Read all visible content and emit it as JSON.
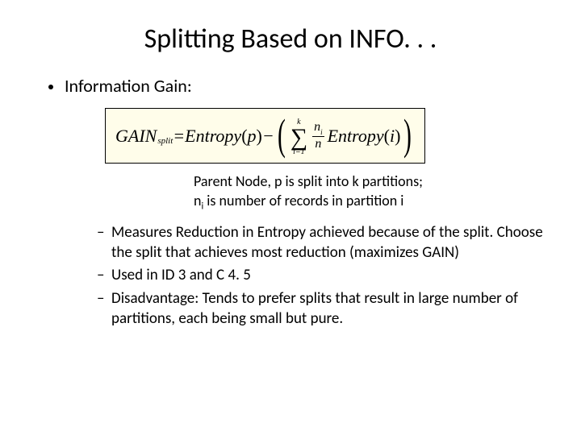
{
  "title": "Splitting Based on INFO. . .",
  "heading": "Information Gain:",
  "formula": {
    "lhs_main": "GAIN",
    "lhs_sub": "split",
    "eq": " = ",
    "entropy_p_fn": "Entropy",
    "entropy_p_arg": "p",
    "minus": " − ",
    "sum_top": "k",
    "sum_bottom": "i=1",
    "frac_num_sym": "n",
    "frac_num_sub": "i",
    "frac_den": "n",
    "entropy_i_fn": "Entropy",
    "entropy_i_arg": "i"
  },
  "caption_line1": "Parent Node, p is split into k partitions;",
  "caption_line2_pre": "n",
  "caption_line2_sub": "i",
  "caption_line2_post": " is number of records in partition i",
  "sub_bullets": [
    "Measures Reduction in Entropy achieved because of the split. Choose the split that achieves most reduction (maximizes GAIN)",
    "Used in ID 3 and C 4. 5",
    "Disadvantage: Tends to prefer splits that result in large number of partitions, each being small but pure."
  ]
}
